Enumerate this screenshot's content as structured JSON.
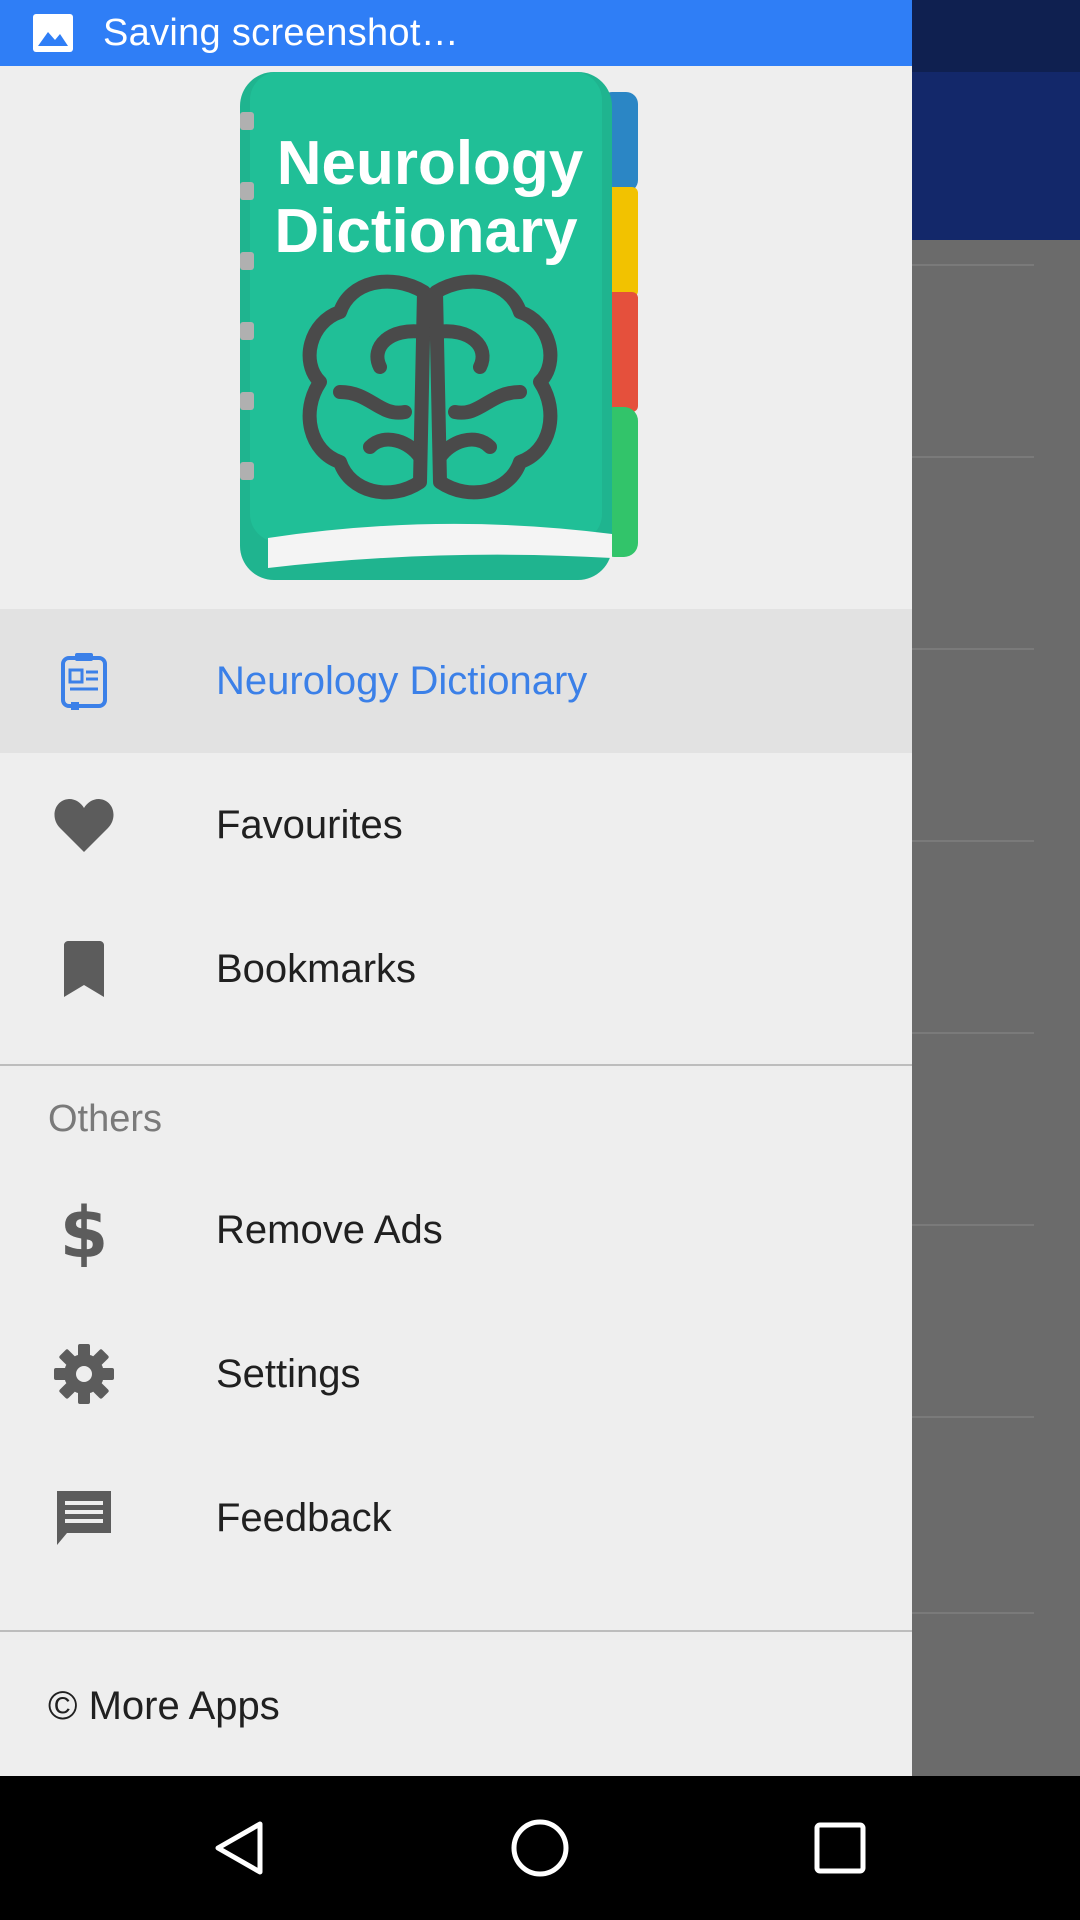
{
  "status_notification": {
    "text": "Saving screenshot…",
    "icon": "image-icon",
    "color": "#2f7ef6"
  },
  "drawer": {
    "logo": {
      "title_line1": "Neurology",
      "title_line2": "Dictionary",
      "icon": "brain-book-logo"
    },
    "items": [
      {
        "label": "Neurology Dictionary",
        "icon": "dictionary-icon",
        "active": true
      },
      {
        "label": "Favourites",
        "icon": "heart-icon",
        "active": false
      },
      {
        "label": "Bookmarks",
        "icon": "bookmark-icon",
        "active": false
      }
    ],
    "others_title": "Others",
    "others": [
      {
        "label": "Remove Ads",
        "icon": "dollar-icon"
      },
      {
        "label": "Settings",
        "icon": "gear-icon"
      },
      {
        "label": "Feedback",
        "icon": "feedback-icon"
      }
    ],
    "more_apps": "© More Apps",
    "accent_color": "#3b80e8"
  },
  "nav_bar": {
    "back": "back-icon",
    "home": "home-icon",
    "recents": "recents-icon"
  }
}
